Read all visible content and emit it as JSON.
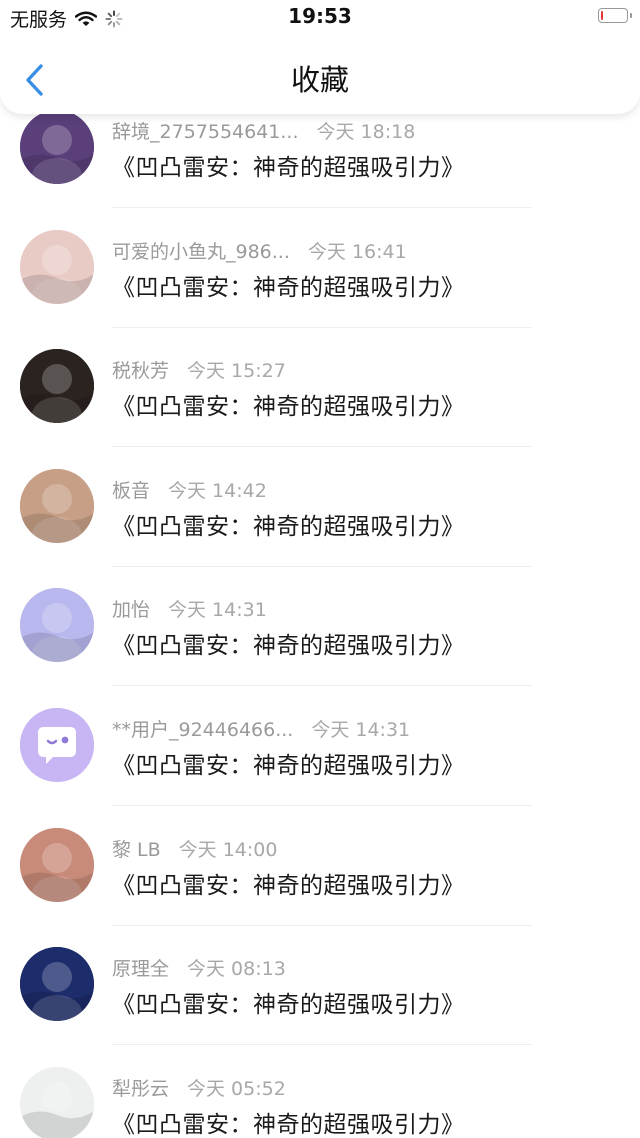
{
  "status_bar": {
    "carrier": "无服务",
    "time": "19:53",
    "battery_level": 0.1,
    "battery_color": "#e53935"
  },
  "nav": {
    "title": "收藏",
    "back_icon": "chevron-left-icon",
    "accent": "#3a8ee6"
  },
  "favorites": [
    {
      "user": "辞境_2757554641...",
      "time": "今天 18:18",
      "title": "《凹凸雷安：神奇的超强吸引力》",
      "avatar_color": "#5a3f7a"
    },
    {
      "user": "可爱的小鱼丸_986...",
      "time": "今天 16:41",
      "title": "《凹凸雷安：神奇的超强吸引力》",
      "avatar_color": "#e9cbc6"
    },
    {
      "user": "税秋芳",
      "time": "今天 15:27",
      "title": "《凹凸雷安：神奇的超强吸引力》",
      "avatar_color": "#2b2320"
    },
    {
      "user": "板音",
      "time": "今天 14:42",
      "title": "《凹凸雷安：神奇的超强吸引力》",
      "avatar_color": "#c79f86"
    },
    {
      "user": "加怡",
      "time": "今天 14:31",
      "title": "《凹凸雷安：神奇的超强吸引力》",
      "avatar_color": "#b9b8ee"
    },
    {
      "user": "**用户_92446466...",
      "time": "今天 14:31",
      "title": "《凹凸雷安：神奇的超强吸引力》",
      "avatar_color": "#c7b6f3"
    },
    {
      "user": "黎 LB",
      "time": "今天 14:00",
      "title": "《凹凸雷安：神奇的超强吸引力》",
      "avatar_color": "#c98b79"
    },
    {
      "user": "原理全",
      "time": "今天 08:13",
      "title": "《凹凸雷安：神奇的超强吸引力》",
      "avatar_color": "#1d2c6b"
    },
    {
      "user": "犁彤云",
      "time": "今天 05:52",
      "title": "《凹凸雷安：神奇的超强吸引力》",
      "avatar_color": "#eef0f0"
    }
  ]
}
